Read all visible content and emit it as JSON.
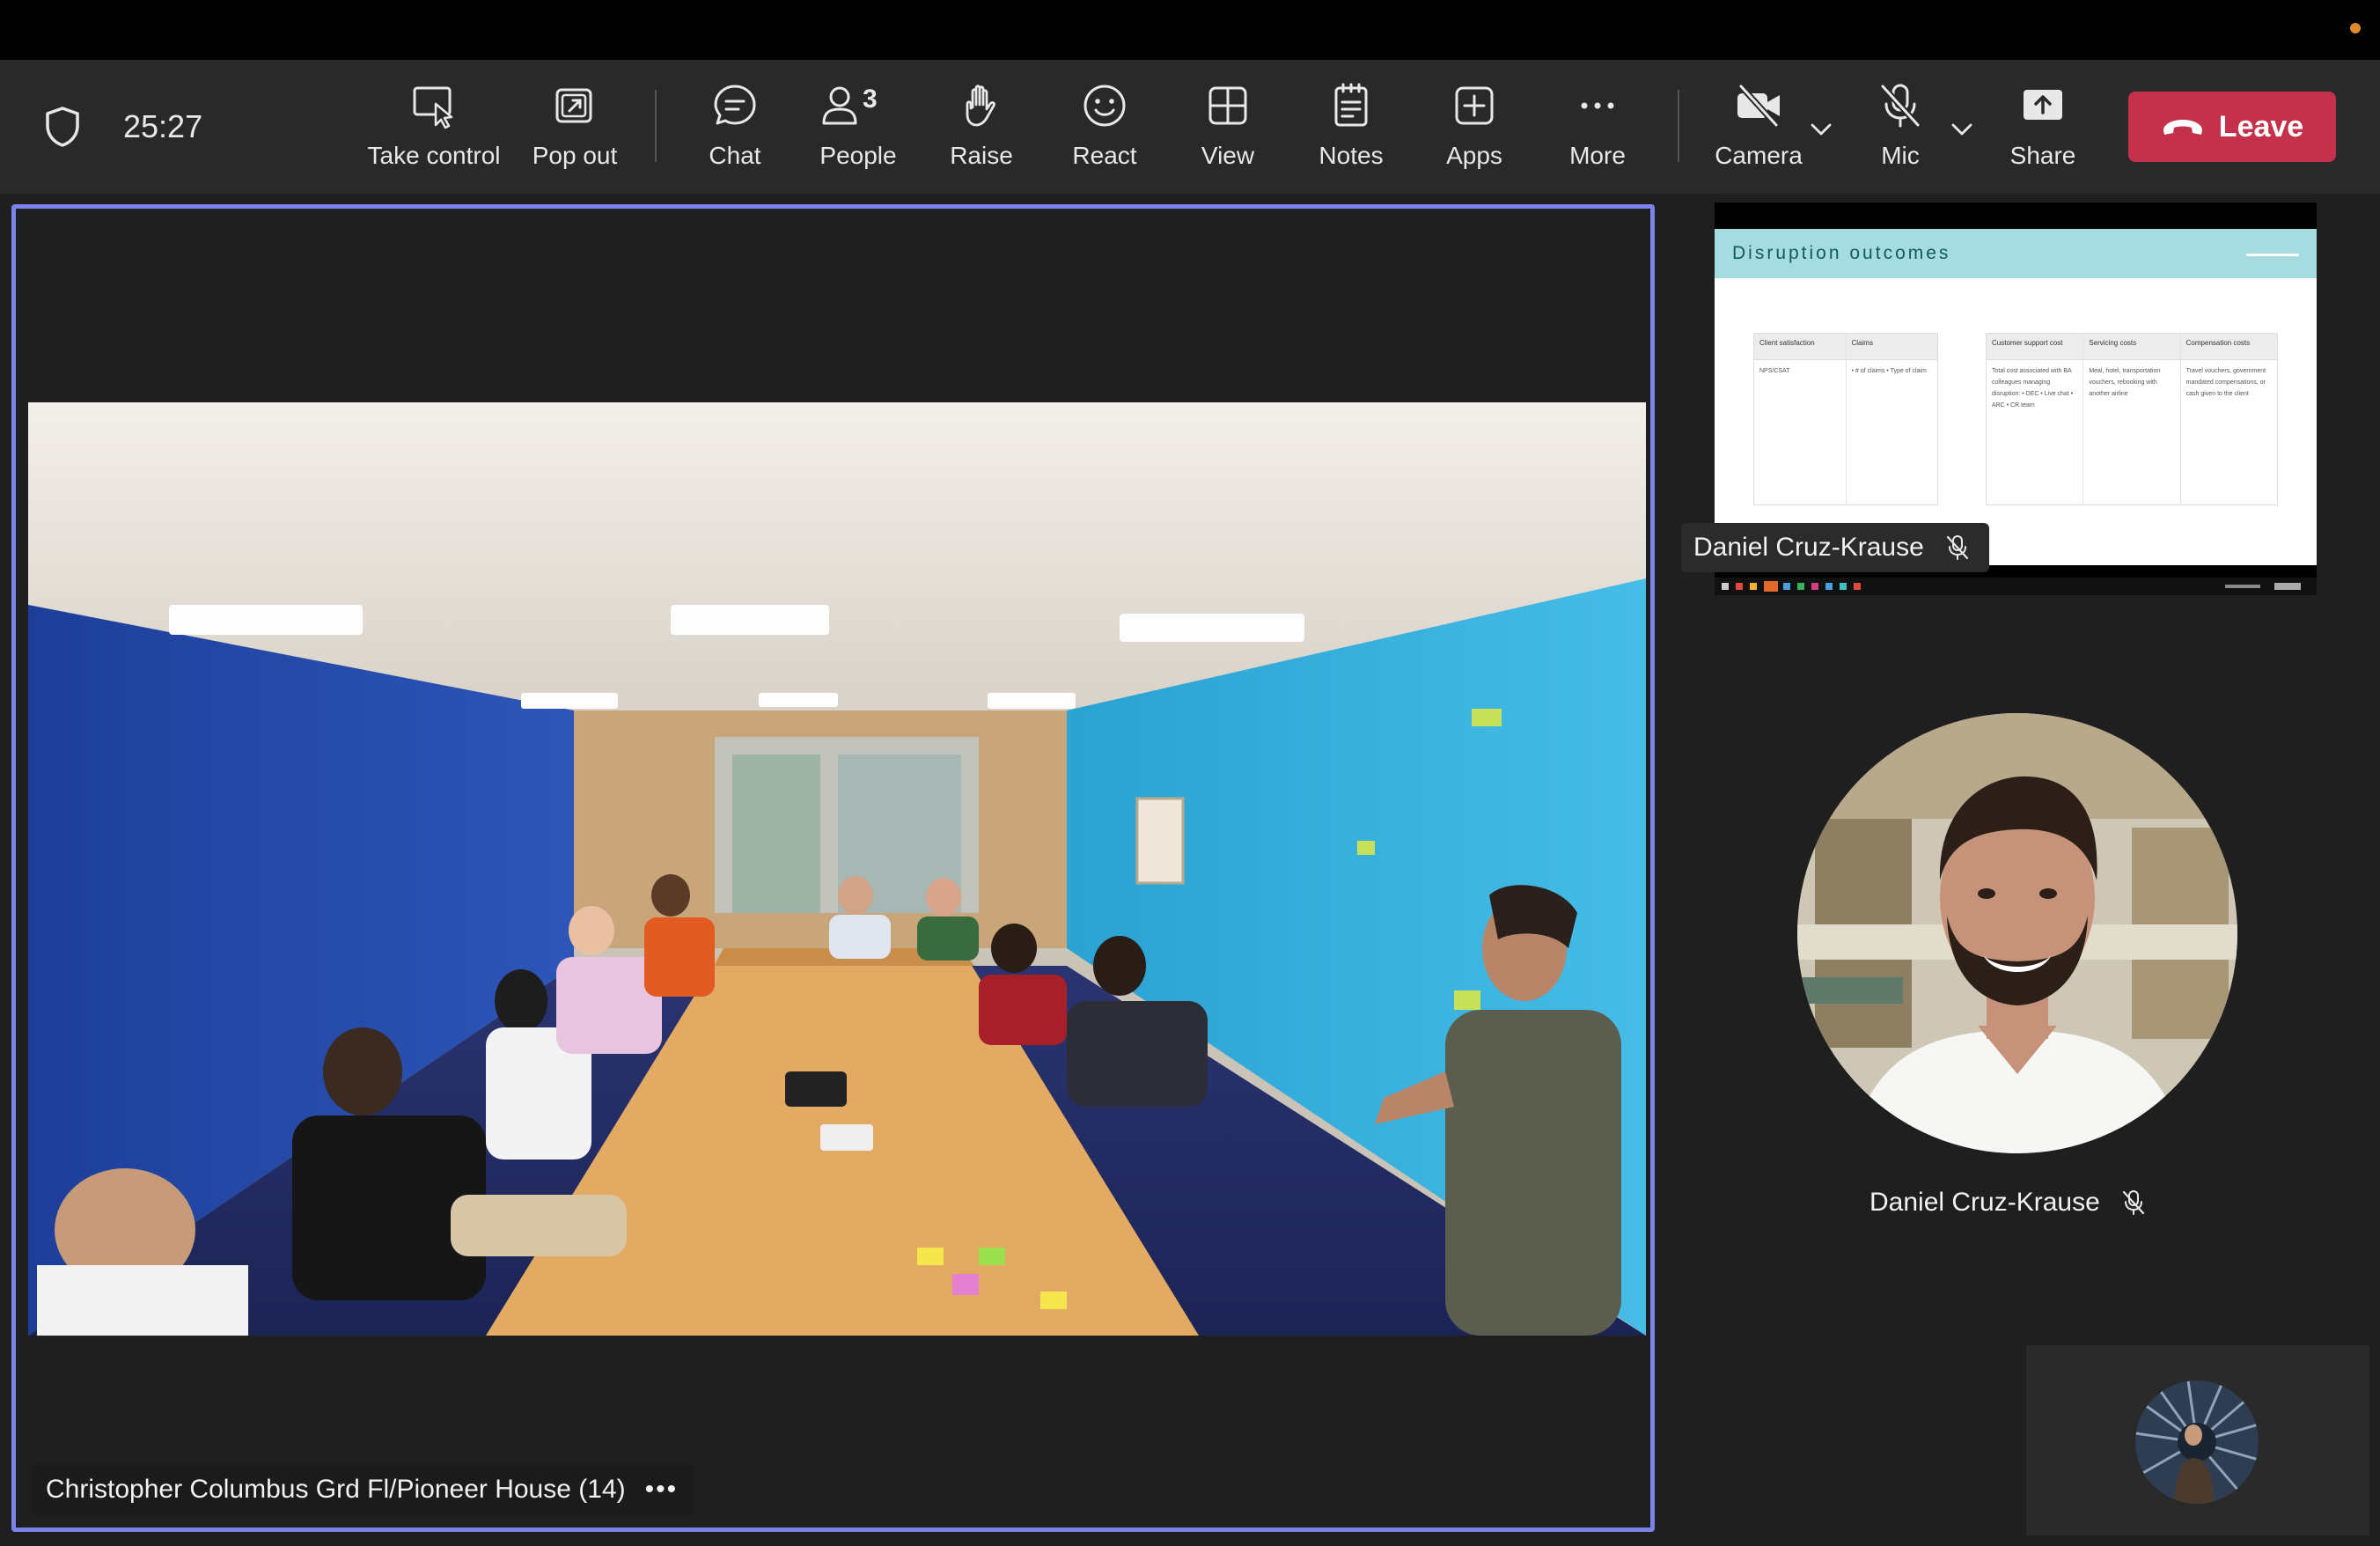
{
  "meeting": {
    "elapsed": "25:27"
  },
  "toolbar": {
    "take_control": "Take control",
    "pop_out": "Pop out",
    "chat": "Chat",
    "people": "People",
    "people_count": "3",
    "raise": "Raise",
    "react": "React",
    "view": "View",
    "notes": "Notes",
    "apps": "Apps",
    "more": "More",
    "camera": "Camera",
    "mic": "Mic",
    "share": "Share",
    "leave": "Leave"
  },
  "icons": {
    "shield": "shield-icon",
    "take_control": "cursor-screen-icon",
    "pop_out": "pop-out-icon",
    "chat": "chat-bubble-icon",
    "people": "people-icon",
    "raise": "raised-hand-icon",
    "react": "smiley-icon",
    "view": "grid-view-icon",
    "notes": "notes-icon",
    "apps": "add-app-icon",
    "more": "ellipsis-icon",
    "camera": "camera-off-icon",
    "mic": "mic-off-icon",
    "share": "share-up-arrow-icon",
    "leave": "phone-hangup-icon"
  },
  "stage": {
    "participant_label": "Christopher Columbus Grd Fl/Pioneer House (14)",
    "more_label": "•••"
  },
  "shared_screen": {
    "presenter_name": "Daniel Cruz-Krause",
    "slide_title": "Disruption outcomes",
    "table_left": {
      "headers": [
        "Client satisfaction",
        "Claims"
      ],
      "cells": [
        "NPS/CSAT",
        "• # of claims\n• Type of claim"
      ]
    },
    "table_right": {
      "headers": [
        "Customer support cost",
        "Servicing costs",
        "Compensation costs"
      ],
      "cells": [
        "Total cost associated with BA colleagues managing disruption: • DEC • Live chat • ARC • CR team",
        "Meal, hotel, transportation vouchers, rebooking with another airline",
        "Travel vouchers, government mandated compensations, or cash given to the client"
      ]
    }
  },
  "participant": {
    "name": "Daniel Cruz-Krause"
  },
  "colors": {
    "accent": "#7b83eb",
    "leave": "#c4314b",
    "toolbar": "#292929",
    "background": "#1f1f1f"
  }
}
